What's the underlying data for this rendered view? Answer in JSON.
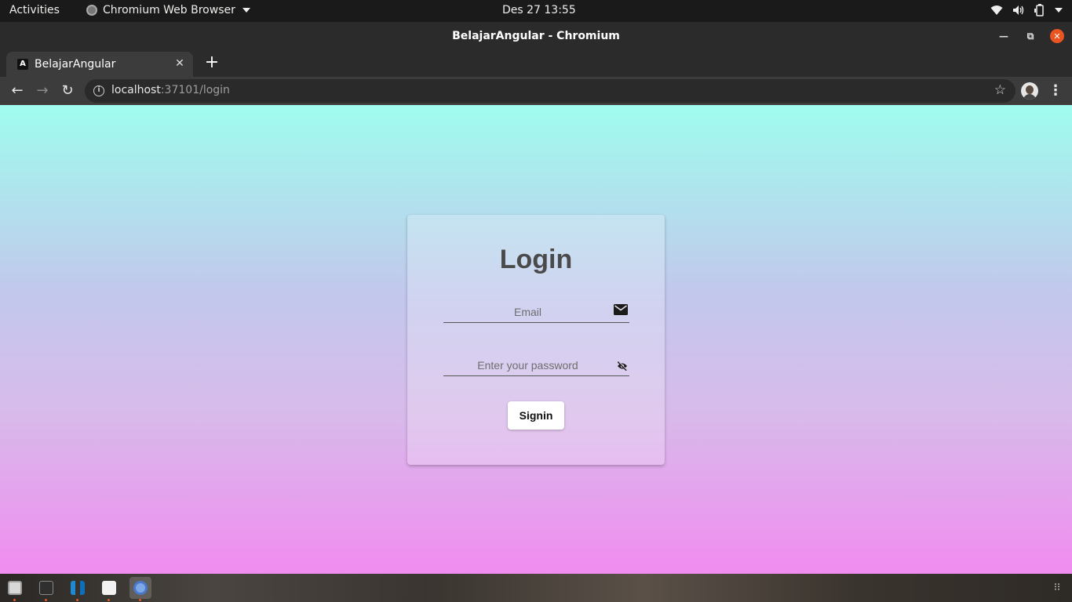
{
  "topbar": {
    "activities": "Activities",
    "app_menu": "Chromium Web Browser",
    "clock": "Des 27  13:55",
    "tray_icons": [
      "wifi-icon",
      "volume-icon",
      "battery-icon",
      "power-menu-icon"
    ]
  },
  "window": {
    "title": "BelajarAngular - Chromium"
  },
  "browser": {
    "tab_title": "BelajarAngular",
    "url_host": "localhost",
    "url_rest": ":37101/login"
  },
  "login": {
    "heading": "Login",
    "email_placeholder": "Email",
    "password_placeholder": "Enter your password",
    "signin_label": "Signin"
  },
  "dock": {
    "apps": [
      "files",
      "terminal",
      "vscode",
      "text-editor",
      "chromium"
    ]
  }
}
